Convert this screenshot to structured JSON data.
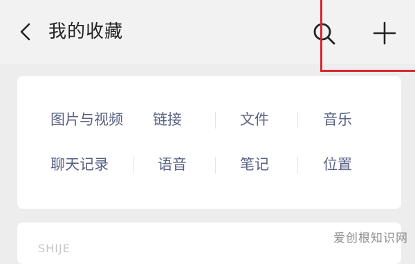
{
  "header": {
    "title": "我的收藏",
    "icons": [
      "back-icon",
      "search-icon",
      "plus-icon"
    ]
  },
  "categories": {
    "row1": [
      "图片与视频",
      "链接",
      "文件",
      "音乐"
    ],
    "row2": [
      "聊天记录",
      "语音",
      "笔记",
      "位置"
    ]
  },
  "second_card_peek": "SHIJE",
  "watermark": "爱创根知识网",
  "colors": {
    "background": "#ededed",
    "card": "#ffffff",
    "category_text": "#5a6185",
    "highlight": "#d9262e"
  }
}
